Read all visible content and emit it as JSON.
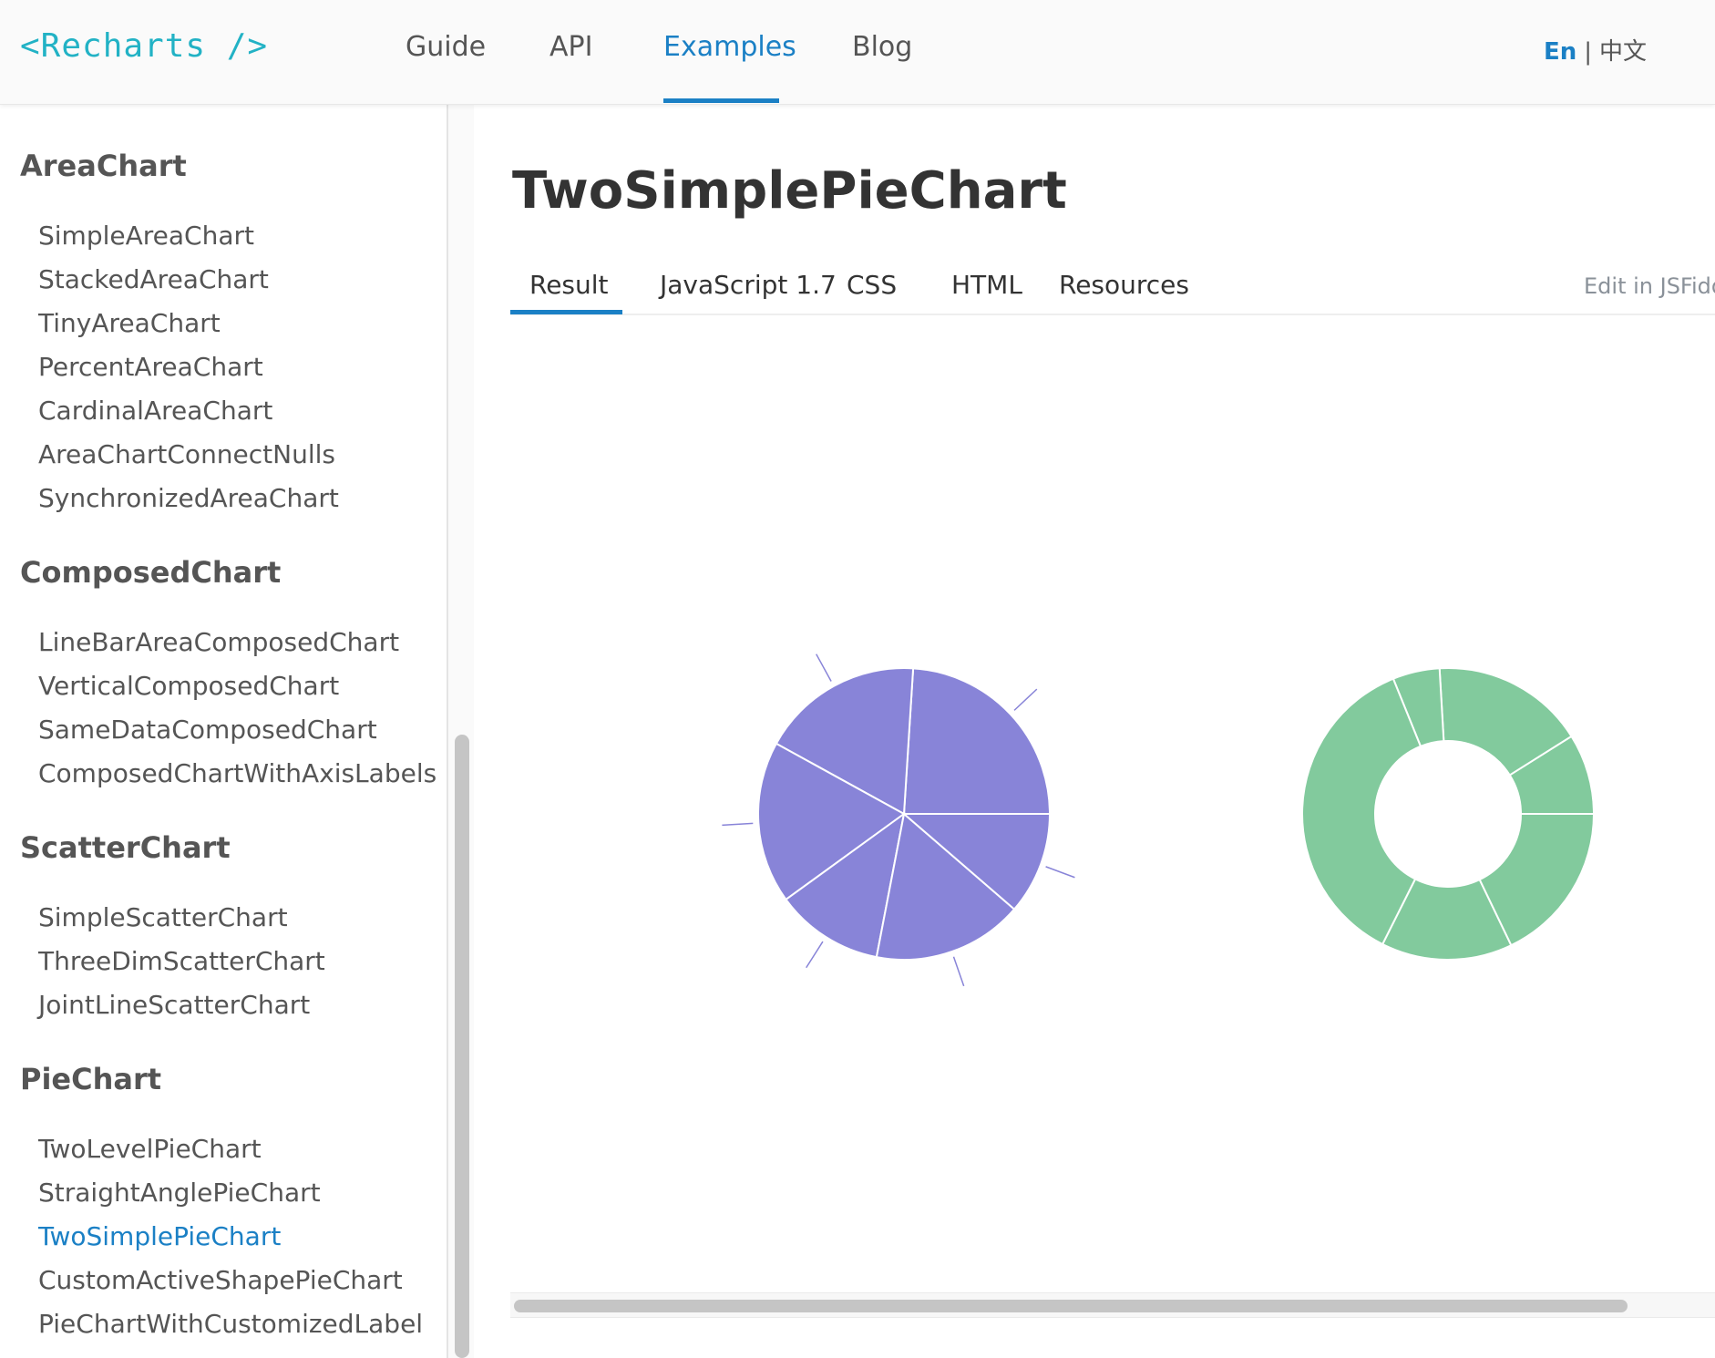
{
  "header": {
    "logo": "<Recharts />",
    "nav": [
      "Guide",
      "API",
      "Examples",
      "Blog"
    ],
    "active_nav": "Examples",
    "locale_en": "En",
    "locale_sep": "|",
    "locale_zh": "中文"
  },
  "sidebar": {
    "groups": [
      {
        "title": "AreaChart",
        "items": [
          "SimpleAreaChart",
          "StackedAreaChart",
          "TinyAreaChart",
          "PercentAreaChart",
          "CardinalAreaChart",
          "AreaChartConnectNulls",
          "SynchronizedAreaChart"
        ]
      },
      {
        "title": "ComposedChart",
        "items": [
          "LineBarAreaComposedChart",
          "VerticalComposedChart",
          "SameDataComposedChart",
          "ComposedChartWithAxisLabels"
        ]
      },
      {
        "title": "ScatterChart",
        "items": [
          "SimpleScatterChart",
          "ThreeDimScatterChart",
          "JointLineScatterChart"
        ]
      },
      {
        "title": "PieChart",
        "items": [
          "TwoLevelPieChart",
          "StraightAnglePieChart",
          "TwoSimplePieChart",
          "CustomActiveShapePieChart",
          "PieChartWithCustomizedLabel"
        ]
      }
    ],
    "active_item": "TwoSimplePieChart"
  },
  "main": {
    "title": "TwoSimplePieChart",
    "tabs": [
      "Result",
      "JavaScript 1.7",
      "CSS",
      "HTML",
      "Resources"
    ],
    "active_tab": "Result",
    "edit_link": "Edit in JSFiddle"
  },
  "colors": {
    "accent": "#1b80c5",
    "logo": "#22b2c5",
    "pie1": "#8884d8",
    "pie2": "#82ca9d"
  },
  "chart_data": [
    {
      "type": "pie",
      "name": "pie-1",
      "fill": "#8884d8",
      "labels": "lines",
      "values": [
        400,
        300,
        300,
        200,
        278,
        189
      ]
    },
    {
      "type": "pie",
      "name": "pie-2-donut",
      "fill": "#82ca9d",
      "inner_radius_ratio": 0.5,
      "values": [
        2400,
        4567,
        1398,
        9800,
        3908,
        4800
      ]
    }
  ]
}
